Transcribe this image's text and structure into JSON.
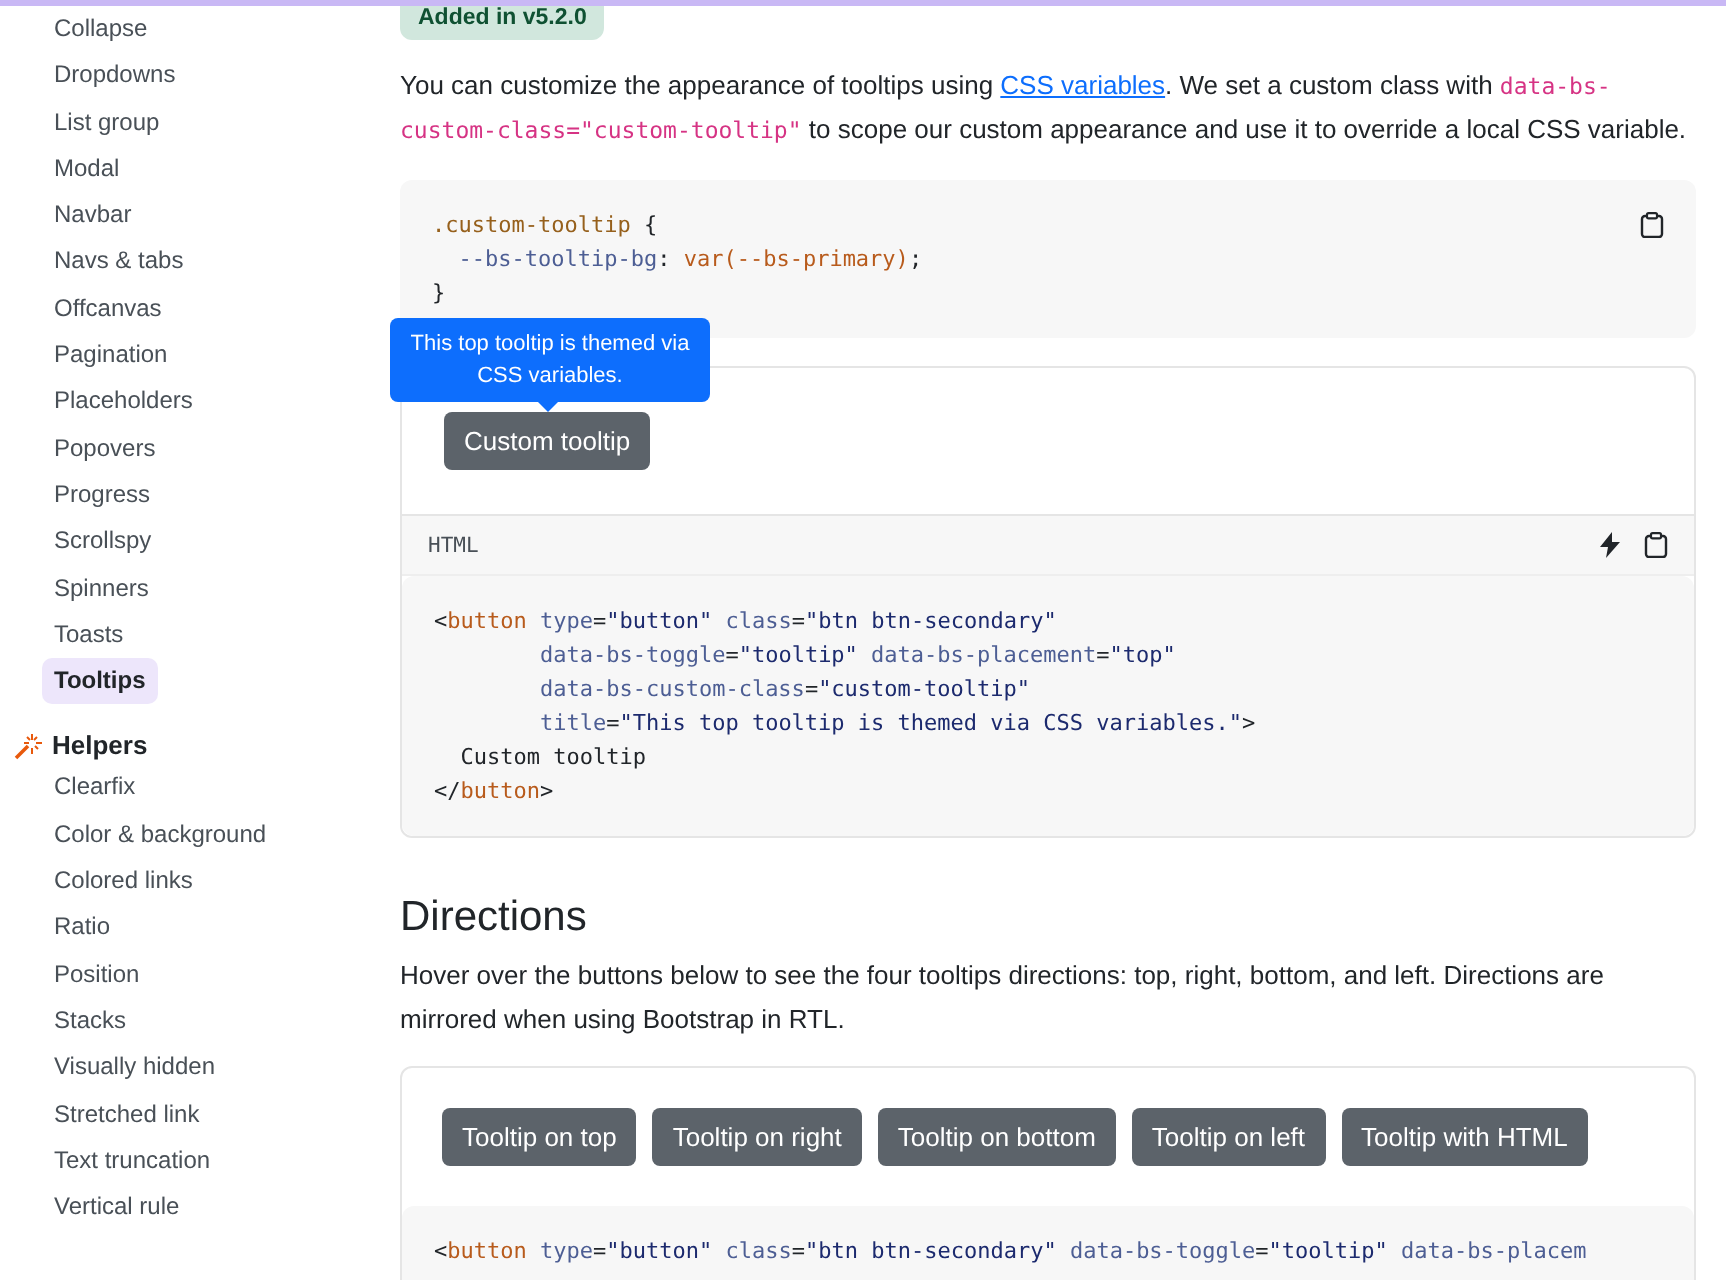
{
  "sidebar": {
    "groups": [
      {
        "items": [
          {
            "label": "Collapse",
            "selected": false
          },
          {
            "label": "Dropdowns",
            "selected": false
          },
          {
            "label": "List group",
            "selected": false
          },
          {
            "label": "Modal",
            "selected": false
          },
          {
            "label": "Navbar",
            "selected": false
          },
          {
            "label": "Navs & tabs",
            "selected": false
          },
          {
            "label": "Offcanvas",
            "selected": false
          },
          {
            "label": "Pagination",
            "selected": false
          },
          {
            "label": "Placeholders",
            "selected": false
          },
          {
            "label": "Popovers",
            "selected": false
          },
          {
            "label": "Progress",
            "selected": false
          },
          {
            "label": "Scrollspy",
            "selected": false
          },
          {
            "label": "Spinners",
            "selected": false
          },
          {
            "label": "Toasts",
            "selected": false
          },
          {
            "label": "Tooltips",
            "selected": true
          }
        ]
      },
      {
        "title": "Helpers",
        "items": [
          {
            "label": "Clearfix",
            "selected": false
          },
          {
            "label": "Color & background",
            "selected": false
          },
          {
            "label": "Colored links",
            "selected": false
          },
          {
            "label": "Ratio",
            "selected": false
          },
          {
            "label": "Position",
            "selected": false
          },
          {
            "label": "Stacks",
            "selected": false
          },
          {
            "label": "Visually hidden",
            "selected": false
          },
          {
            "label": "Stretched link",
            "selected": false
          },
          {
            "label": "Text truncation",
            "selected": false
          },
          {
            "label": "Vertical rule",
            "selected": false
          }
        ]
      }
    ]
  },
  "badge": "Added in v5.2.0",
  "intro": [
    {
      "kind": "text",
      "text": "You can customize the appearance of tooltips using "
    },
    {
      "kind": "link",
      "text": "CSS variables"
    },
    {
      "kind": "text",
      "text": ". We set a custom class with "
    },
    {
      "kind": "code",
      "text": "data-bs-custom-class=\"custom-tooltip\""
    },
    {
      "kind": "text",
      "text": " to scope our custom appearance and use it to override a local CSS variable."
    }
  ],
  "css_code": [
    [
      {
        "kind": "sel",
        "text": ".custom-tooltip"
      },
      {
        "kind": "plain",
        "text": " {"
      }
    ],
    [
      {
        "kind": "attr",
        "text": "  --bs-tooltip-bg"
      },
      {
        "kind": "plain",
        "text": ": "
      },
      {
        "kind": "tag",
        "text": "var(--bs-primary)"
      },
      {
        "kind": "plain",
        "text": ";"
      }
    ],
    [
      {
        "kind": "plain",
        "text": "}"
      }
    ]
  ],
  "example": {
    "tooltip": "This top tooltip is themed via CSS variables.",
    "button": "Custom tooltip",
    "lang": "HTML"
  },
  "html_code": [
    [
      {
        "kind": "plain",
        "text": "<"
      },
      {
        "kind": "tag",
        "text": "button"
      },
      {
        "kind": "attr",
        "text": " type"
      },
      {
        "kind": "plain",
        "text": "="
      },
      {
        "kind": "str",
        "text": "\"button\""
      },
      {
        "kind": "attr",
        "text": " class"
      },
      {
        "kind": "plain",
        "text": "="
      },
      {
        "kind": "str",
        "text": "\"btn btn-secondary\""
      }
    ],
    [
      {
        "kind": "attr",
        "text": "        data-bs-toggle"
      },
      {
        "kind": "plain",
        "text": "="
      },
      {
        "kind": "str",
        "text": "\"tooltip\""
      },
      {
        "kind": "attr",
        "text": " data-bs-placement"
      },
      {
        "kind": "plain",
        "text": "="
      },
      {
        "kind": "str",
        "text": "\"top\""
      }
    ],
    [
      {
        "kind": "attr",
        "text": "        data-bs-custom-class"
      },
      {
        "kind": "plain",
        "text": "="
      },
      {
        "kind": "str",
        "text": "\"custom-tooltip\""
      }
    ],
    [
      {
        "kind": "attr",
        "text": "        title"
      },
      {
        "kind": "plain",
        "text": "="
      },
      {
        "kind": "str",
        "text": "\"This top tooltip is themed via CSS variables.\""
      },
      {
        "kind": "plain",
        "text": ">"
      }
    ],
    [
      {
        "kind": "plain",
        "text": "  Custom tooltip"
      }
    ],
    [
      {
        "kind": "plain",
        "text": "</"
      },
      {
        "kind": "tag",
        "text": "button"
      },
      {
        "kind": "plain",
        "text": ">"
      }
    ]
  ],
  "directions": {
    "heading": "Directions",
    "text": "Hover over the buttons below to see the four tooltips directions: top, right, bottom, and left. Directions are mirrored when using Bootstrap in RTL.",
    "buttons": [
      "Tooltip on top",
      "Tooltip on right",
      "Tooltip on bottom",
      "Tooltip on left",
      "Tooltip with HTML"
    ],
    "code": [
      [
        {
          "kind": "plain",
          "text": "<"
        },
        {
          "kind": "tag",
          "text": "button"
        },
        {
          "kind": "attr",
          "text": " type"
        },
        {
          "kind": "plain",
          "text": "="
        },
        {
          "kind": "str",
          "text": "\"button\""
        },
        {
          "kind": "attr",
          "text": " class"
        },
        {
          "kind": "plain",
          "text": "="
        },
        {
          "kind": "str",
          "text": "\"btn btn-secondary\""
        },
        {
          "kind": "attr",
          "text": " data-bs-toggle"
        },
        {
          "kind": "plain",
          "text": "="
        },
        {
          "kind": "str",
          "text": "\"tooltip\""
        },
        {
          "kind": "attr",
          "text": " data-bs-placem"
        }
      ]
    ]
  }
}
